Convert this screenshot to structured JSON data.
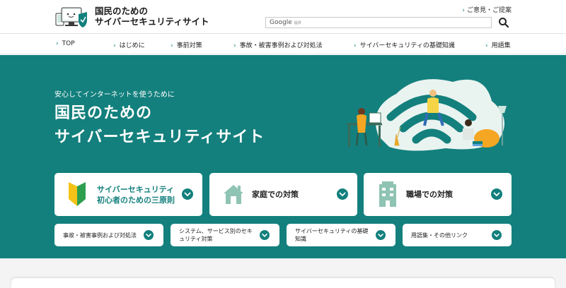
{
  "header": {
    "title_line1": "国民のための",
    "title_line2": "サイバーセキュリティサイト",
    "feedback_label": "ご意見・ご提案",
    "search": {
      "brand": "Google",
      "brand_sub": "提供",
      "value": ""
    }
  },
  "nav": {
    "items": [
      {
        "label": "TOP"
      },
      {
        "label": "はじめに"
      },
      {
        "label": "事前対策"
      },
      {
        "label": "事故・被害事例および対処法"
      },
      {
        "label": "サイバーセキュリティの基礎知識"
      },
      {
        "label": "用語集"
      }
    ]
  },
  "hero": {
    "subtitle": "安心してインターネットを使うために",
    "title_line1": "国民のための",
    "title_line2": "サイバーセキュリティサイト"
  },
  "cards_large": [
    {
      "line1": "サイバーセキュリティ",
      "line2": "初心者のための三原則",
      "icon": "beginner-mark-icon"
    },
    {
      "line1": "家庭での対策",
      "line2": "",
      "icon": "house-icon"
    },
    {
      "line1": "職場での対策",
      "line2": "",
      "icon": "office-building-icon"
    }
  ],
  "cards_small": [
    {
      "line1": "事故・被害事例および対処法",
      "line2": ""
    },
    {
      "line1": "システム、サービス別のセキ",
      "line2": "ュリティ対策"
    },
    {
      "line1": "サイバーセキュリティの基礎",
      "line2": "知識"
    },
    {
      "line1": "用語集・その他リンク",
      "line2": ""
    }
  ],
  "colors": {
    "brand_teal": "#13807d",
    "card_bg": "#ffffff",
    "beginner_green": "#2e9e4f",
    "beginner_yellow": "#f5c318",
    "icon_teal_light": "#8fc3b3"
  }
}
